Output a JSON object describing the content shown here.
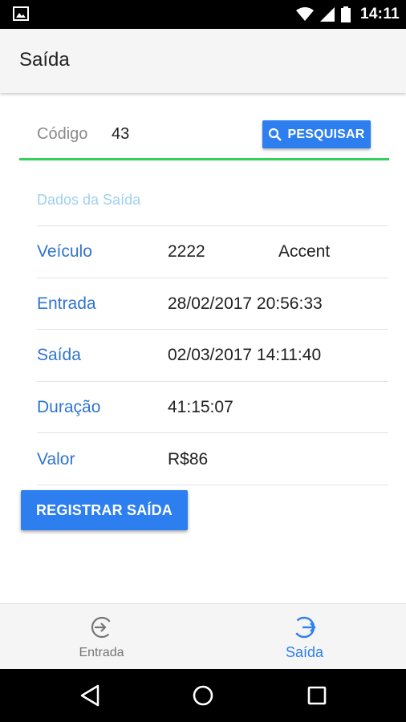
{
  "status_bar": {
    "time": "14:11"
  },
  "app_bar": {
    "title": "Saída"
  },
  "search": {
    "label": "Código",
    "value": "43",
    "button_label": "PESQUISAR"
  },
  "section": {
    "title": "Dados da Saída"
  },
  "rows": [
    {
      "label": "Veículo",
      "value": "2222",
      "extra": "Accent"
    },
    {
      "label": "Entrada",
      "value": "28/02/2017 20:56:33"
    },
    {
      "label": "Saída",
      "value": "02/03/2017 14:11:40"
    },
    {
      "label": "Duração",
      "value": "41:15:07"
    },
    {
      "label": "Valor",
      "value": "R$86"
    }
  ],
  "register_button": {
    "label": "REGISTRAR SAÍDA"
  },
  "bottom_nav": {
    "items": [
      {
        "label": "Entrada",
        "icon": "login-icon",
        "active": false
      },
      {
        "label": "Saída",
        "icon": "logout-icon",
        "active": true
      }
    ]
  },
  "colors": {
    "accent": "#2d7ff0",
    "label_blue": "#2f74d0",
    "section_title": "#9ed0f2",
    "underline_green": "#32d25a"
  }
}
